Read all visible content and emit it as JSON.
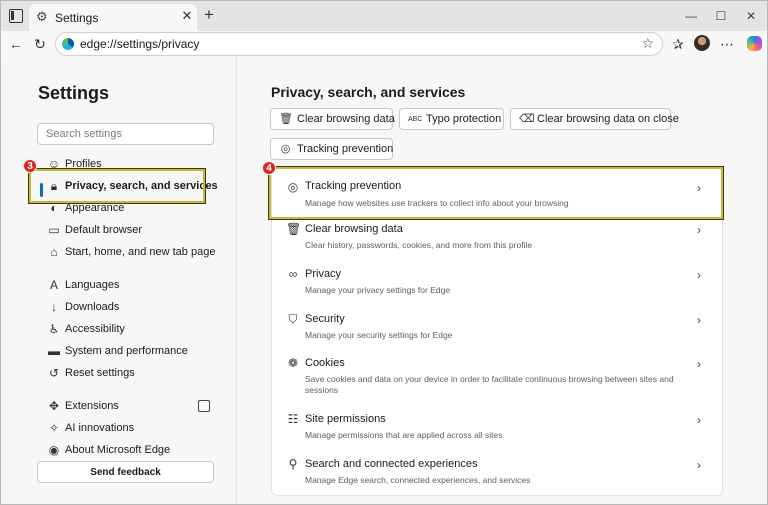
{
  "browser": {
    "tab_title": "Settings",
    "tab_close": "✕",
    "new_tab": "+",
    "url": "edge://settings/privacy",
    "minimize": "—",
    "maximize": "☐",
    "close": "✕"
  },
  "sidebar": {
    "title": "Settings",
    "search_placeholder": "Search settings",
    "items": [
      {
        "label": "Profiles",
        "icon": "person-icon"
      },
      {
        "label": "Privacy, search, and services",
        "icon": "lock-icon"
      },
      {
        "label": "Appearance",
        "icon": "palette-icon"
      },
      {
        "label": "Default browser",
        "icon": "browser-icon"
      },
      {
        "label": "Start, home, and new tab page",
        "icon": "home-icon"
      },
      {
        "label": "Languages",
        "icon": "language-icon"
      },
      {
        "label": "Downloads",
        "icon": "download-icon"
      },
      {
        "label": "Accessibility",
        "icon": "accessibility-icon"
      },
      {
        "label": "System and performance",
        "icon": "laptop-icon"
      },
      {
        "label": "Reset settings",
        "icon": "reset-icon"
      },
      {
        "label": "Extensions",
        "icon": "puzzle-icon"
      },
      {
        "label": "AI innovations",
        "icon": "sparkle-icon"
      },
      {
        "label": "About Microsoft Edge",
        "icon": "edge-icon"
      }
    ],
    "feedback_label": "Send feedback"
  },
  "annotations": {
    "step3": "3",
    "step4": "4",
    "highlight_color": "#c9b737",
    "badge_color": "#e2231a"
  },
  "main": {
    "title": "Privacy, search, and services",
    "quick_buttons": [
      {
        "label": "Clear browsing data",
        "icon": "trash-icon"
      },
      {
        "label": "Typo protection",
        "icon": "spellcheck-icon"
      },
      {
        "label": "Clear browsing data on close",
        "icon": "clear-on-close-icon"
      },
      {
        "label": "Tracking prevention",
        "icon": "tracking-icon"
      }
    ],
    "rows": [
      {
        "title": "Tracking prevention",
        "desc": "Manage how websites use trackers to collect info about your browsing",
        "icon": "tracking-icon"
      },
      {
        "title": "Clear browsing data",
        "desc": "Clear history, passwords, cookies, and more from this profile",
        "icon": "trash-icon"
      },
      {
        "title": "Privacy",
        "desc": "Manage your privacy settings for Edge",
        "icon": "glasses-icon"
      },
      {
        "title": "Security",
        "desc": "Manage your security settings for Edge",
        "icon": "shield-icon"
      },
      {
        "title": "Cookies",
        "desc": "Save cookies and data on your device in order to facilitate continuous browsing between sites and sessions",
        "icon": "cookie-icon"
      },
      {
        "title": "Site permissions",
        "desc": "Manage permissions that are applied across all sites",
        "icon": "permissions-icon"
      },
      {
        "title": "Search and connected experiences",
        "desc": "Manage Edge search, connected experiences, and services",
        "icon": "search-icon"
      }
    ]
  }
}
